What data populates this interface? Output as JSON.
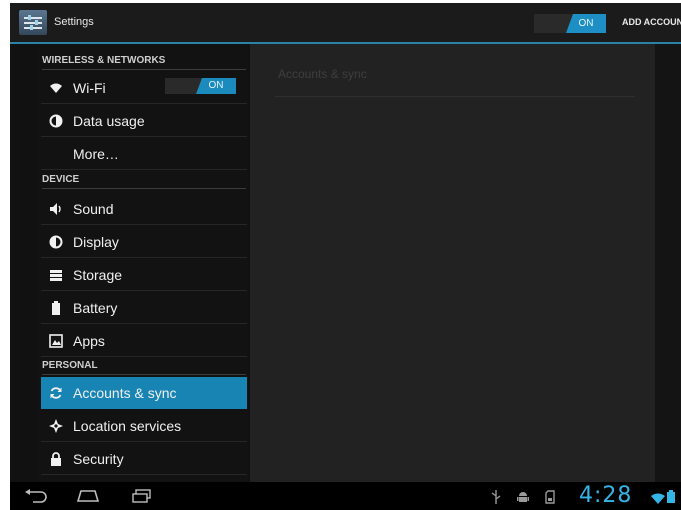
{
  "action_bar": {
    "title": "Settings",
    "toggle_on_label": "ON",
    "add_account_label": "ADD ACCOUNT"
  },
  "sidebar": {
    "sections": [
      {
        "header": "WIRELESS & NETWORKS",
        "items": [
          {
            "label": "Wi-Fi",
            "icon": "wifi-icon",
            "toggle": "ON"
          },
          {
            "label": "Data usage",
            "icon": "data-usage-icon"
          },
          {
            "label": "More…",
            "icon": ""
          }
        ]
      },
      {
        "header": "DEVICE",
        "items": [
          {
            "label": "Sound",
            "icon": "speaker-icon"
          },
          {
            "label": "Display",
            "icon": "display-icon"
          },
          {
            "label": "Storage",
            "icon": "storage-icon"
          },
          {
            "label": "Battery",
            "icon": "battery-icon"
          },
          {
            "label": "Apps",
            "icon": "apps-icon"
          }
        ]
      },
      {
        "header": "PERSONAL",
        "items": [
          {
            "label": "Accounts & sync",
            "icon": "sync-icon",
            "selected": true
          },
          {
            "label": "Location services",
            "icon": "location-icon"
          },
          {
            "label": "Security",
            "icon": "lock-icon"
          }
        ]
      }
    ]
  },
  "content": {
    "title": "Accounts & sync"
  },
  "status_bar": {
    "time": "4:28"
  },
  "colors": {
    "accent": "#33b5e5",
    "selected": "#1784b4",
    "background": "#111111"
  }
}
